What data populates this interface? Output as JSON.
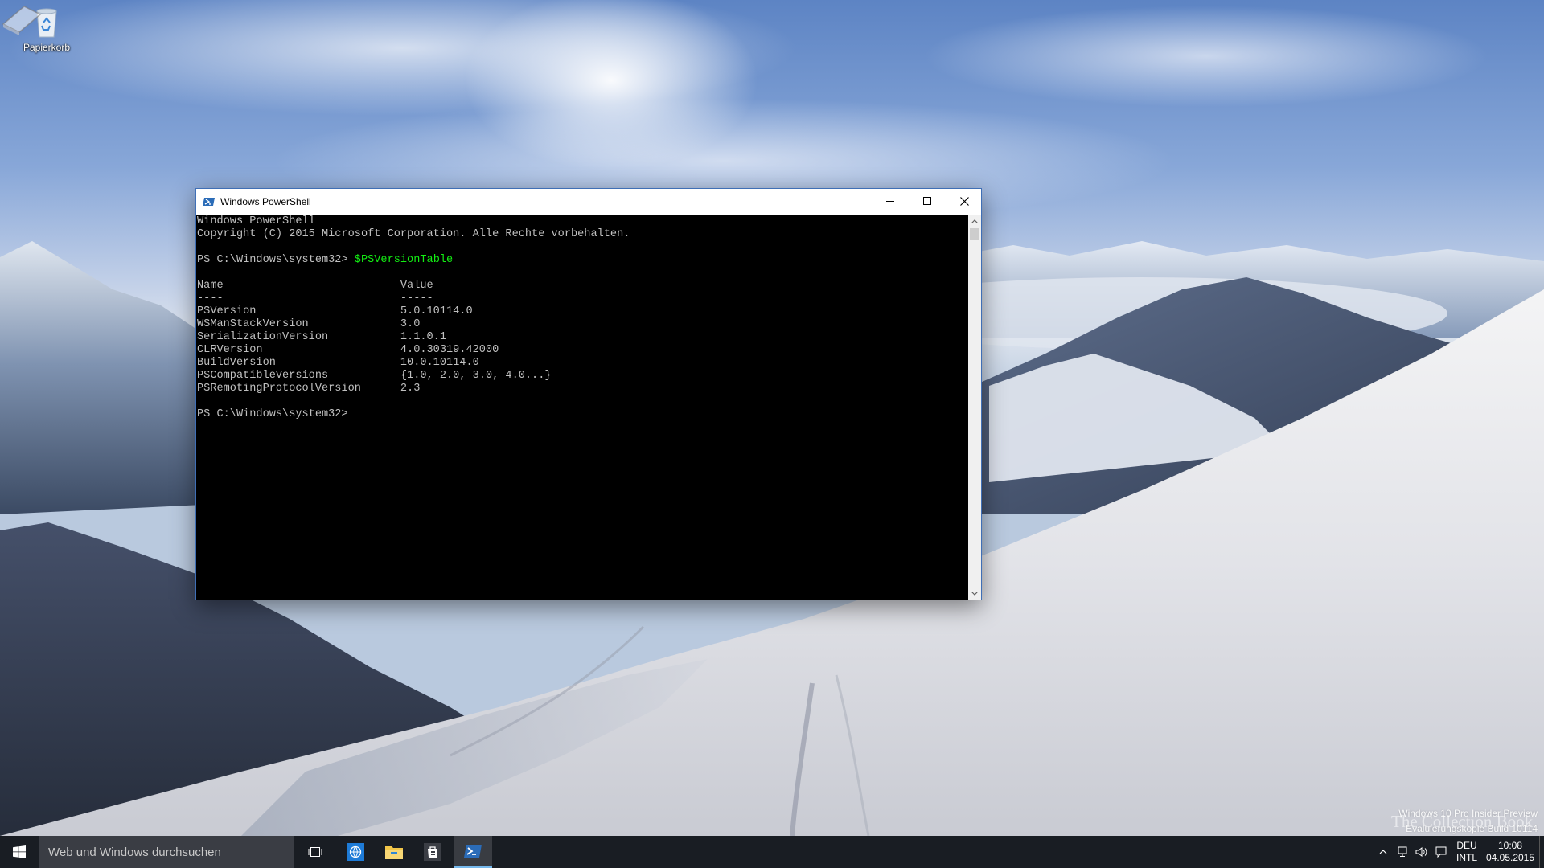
{
  "desktop": {
    "icons": [
      {
        "label": "Papierkorb",
        "icon": "recycle-bin-icon"
      }
    ],
    "watermark": {
      "line1": "Windows 10 Pro Insider Preview",
      "line2": "Evaluierungskopie Build 10114",
      "brand": "The Collection Book"
    }
  },
  "window": {
    "title": "Windows PowerShell",
    "icon": "powershell-icon",
    "controls": [
      "minimize-icon",
      "maximize-icon",
      "close-icon"
    ],
    "console": {
      "lines": {
        "header1": "Windows PowerShell",
        "header2": "Copyright (C) 2015 Microsoft Corporation. Alle Rechte vorbehalten.",
        "prompt1": "PS C:\\Windows\\system32> ",
        "command1": "$PSVersionTable",
        "table_header": "Name                           Value",
        "table_rule": "----                           -----",
        "prompt2": "PS C:\\Windows\\system32> "
      },
      "table_rows": [
        {
          "name": "PSVersion",
          "value": "5.0.10114.0"
        },
        {
          "name": "WSManStackVersion",
          "value": "3.0"
        },
        {
          "name": "SerializationVersion",
          "value": "1.1.0.1"
        },
        {
          "name": "CLRVersion",
          "value": "4.0.30319.42000"
        },
        {
          "name": "BuildVersion",
          "value": "10.0.10114.0"
        },
        {
          "name": "PSCompatibleVersions",
          "value": "{1.0, 2.0, 3.0, 4.0...}"
        },
        {
          "name": "PSRemotingProtocolVersion",
          "value": "2.3"
        }
      ],
      "colors": {
        "background": "#000000",
        "text": "#c0c0c0",
        "command": "#13ee13"
      }
    }
  },
  "taskbar": {
    "start_icon": "windows-logo-icon",
    "search_placeholder": "Web und Windows durchsuchen",
    "pinned": [
      "task-view-icon",
      "browser-icon",
      "file-explorer-icon",
      "store-icon",
      "powershell-icon"
    ],
    "active_app": "powershell-icon",
    "tray": {
      "icons": [
        "chevron-up-icon",
        "network-icon",
        "volume-icon",
        "action-center-icon"
      ],
      "language": "DEU",
      "layout": "INTL",
      "time": "10:08",
      "date": "04.05.2015"
    }
  }
}
